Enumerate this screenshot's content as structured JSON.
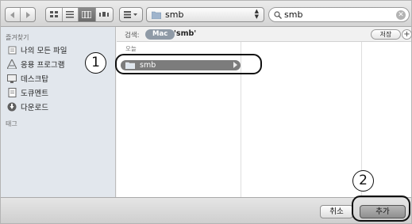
{
  "toolbar": {
    "path_popup_label": "smb",
    "search_value": "smb"
  },
  "sidebar": {
    "favorites_heading": "즐겨찾기",
    "items": [
      {
        "label": "나의 모든 파일",
        "icon": "all-files-icon"
      },
      {
        "label": "응용 프로그램",
        "icon": "applications-icon"
      },
      {
        "label": "데스크탑",
        "icon": "desktop-icon"
      },
      {
        "label": "도큐멘트",
        "icon": "documents-icon"
      },
      {
        "label": "다운로드",
        "icon": "downloads-icon"
      }
    ],
    "tags_heading": "태그"
  },
  "scope_bar": {
    "label": "검색:",
    "scope": "Mac",
    "term": "'smb'",
    "save_label": "저장",
    "plus_label": "+"
  },
  "results": {
    "group_label": "오늘",
    "rows": [
      {
        "name": "smb",
        "selected": true
      }
    ]
  },
  "buttons": {
    "cancel_label": "취소",
    "add_label": "추가"
  },
  "annotations": {
    "step1": "1",
    "step2": "2"
  },
  "colors": {
    "sidebar_bg": "#e2e7ed",
    "selection": "#7c7c7c",
    "scope_pill": "#8f9aa6"
  }
}
